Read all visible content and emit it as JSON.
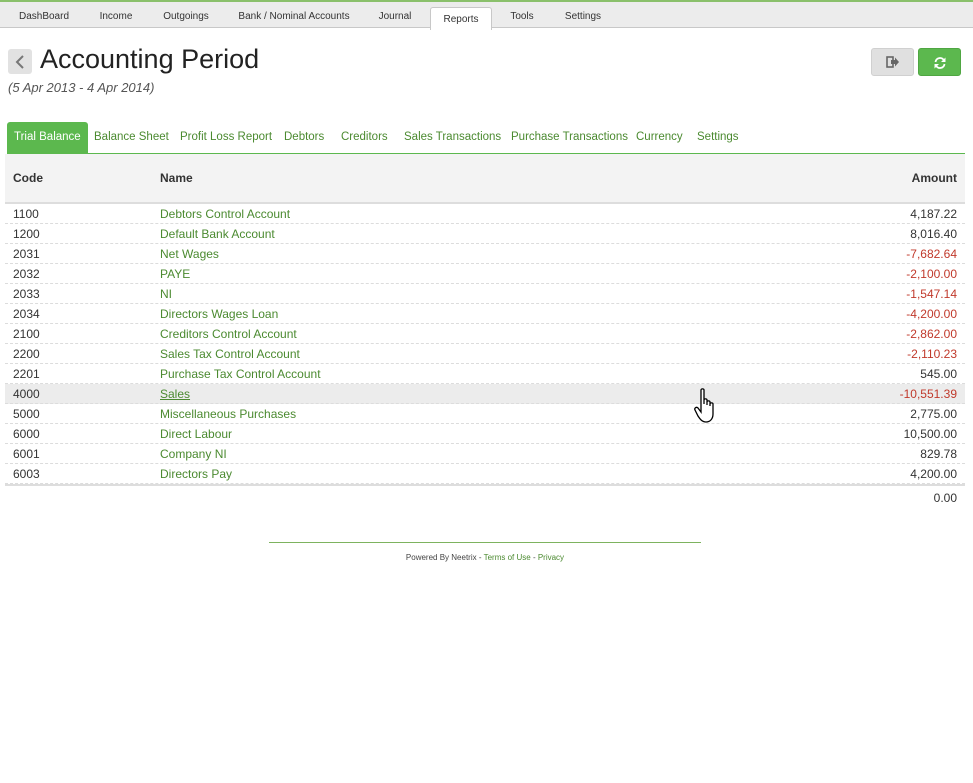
{
  "topnav": {
    "tabs": [
      {
        "label": "DashBoard",
        "active": false
      },
      {
        "label": "Income",
        "active": false
      },
      {
        "label": "Outgoings",
        "active": false
      },
      {
        "label": "Bank / Nominal Accounts",
        "active": false
      },
      {
        "label": "Journal",
        "active": false
      },
      {
        "label": "Reports",
        "active": true
      },
      {
        "label": "Tools",
        "active": false
      },
      {
        "label": "Settings",
        "active": false
      }
    ]
  },
  "header": {
    "title": "Accounting Period",
    "period": "(5 Apr 2013 - 4 Apr 2014)",
    "back_icon": "chevron-left-icon",
    "export_icon": "sign-out-icon",
    "refresh_icon": "refresh-icon"
  },
  "subtabs": [
    {
      "label": "Trial Balance",
      "active": true
    },
    {
      "label": "Balance Sheet",
      "active": false
    },
    {
      "label": "Profit Loss Report",
      "active": false
    },
    {
      "label": "Debtors",
      "active": false
    },
    {
      "label": "Creditors",
      "active": false
    },
    {
      "label": "Sales Transactions",
      "active": false
    },
    {
      "label": "Purchase Transactions",
      "active": false
    },
    {
      "label": "Currency",
      "active": false
    },
    {
      "label": "Settings",
      "active": false
    }
  ],
  "table": {
    "columns": {
      "code": "Code",
      "name": "Name",
      "amount": "Amount"
    },
    "rows": [
      {
        "code": "1100",
        "name": "Debtors Control Account",
        "amount": "4,187.22"
      },
      {
        "code": "1200",
        "name": "Default Bank Account",
        "amount": "8,016.40"
      },
      {
        "code": "2031",
        "name": "Net Wages",
        "amount": "-7,682.64"
      },
      {
        "code": "2032",
        "name": "PAYE",
        "amount": "-2,100.00"
      },
      {
        "code": "2033",
        "name": "NI",
        "amount": "-1,547.14"
      },
      {
        "code": "2034",
        "name": "Directors Wages Loan",
        "amount": "-4,200.00"
      },
      {
        "code": "2100",
        "name": "Creditors Control Account",
        "amount": "-2,862.00"
      },
      {
        "code": "2200",
        "name": "Sales Tax Control Account",
        "amount": "-2,110.23"
      },
      {
        "code": "2201",
        "name": "Purchase Tax Control Account",
        "amount": "545.00"
      },
      {
        "code": "4000",
        "name": "Sales",
        "amount": "-10,551.39"
      },
      {
        "code": "5000",
        "name": "Miscellaneous Purchases",
        "amount": "2,775.00"
      },
      {
        "code": "6000",
        "name": "Direct Labour",
        "amount": "10,500.00"
      },
      {
        "code": "6001",
        "name": "Company NI",
        "amount": "829.78"
      },
      {
        "code": "6003",
        "name": "Directors Pay",
        "amount": "4,200.00"
      }
    ],
    "total": "0.00"
  },
  "footer": {
    "powered": "Powered By Neetrix",
    "sep1": " - ",
    "terms": "Terms of Use",
    "sep2": " - ",
    "privacy": "Privacy"
  },
  "colors": {
    "accent": "#5cb84e",
    "link": "#4b8a30",
    "negative": "#c0392b"
  }
}
